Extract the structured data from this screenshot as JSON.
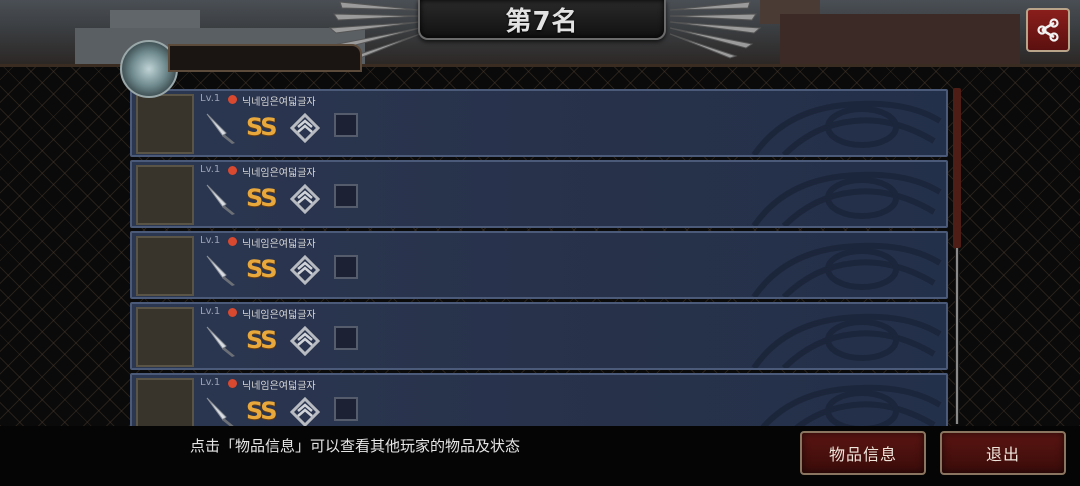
{
  "header": {
    "rank_title": "第7名",
    "share_icon": "share-icon"
  },
  "rows": [
    {
      "level": "Lv.1",
      "name": "닉네임은여덟글자",
      "grade": "SS"
    },
    {
      "level": "Lv.1",
      "name": "닉네임은여덟글자",
      "grade": "SS"
    },
    {
      "level": "Lv.1",
      "name": "닉네임은여덟글자",
      "grade": "SS"
    },
    {
      "level": "Lv.1",
      "name": "닉네임은여덟글자",
      "grade": "SS"
    },
    {
      "level": "Lv.1",
      "name": "닉네임은여덟글자",
      "grade": "SS"
    }
  ],
  "footer": {
    "hint": "点击「物品信息」可以查看其他玩家的物品及状态",
    "item_info_label": "物品信息",
    "exit_label": "退出"
  },
  "colors": {
    "grade": "#e9a83b",
    "button": "#5a1512",
    "row": "#2b3650"
  }
}
